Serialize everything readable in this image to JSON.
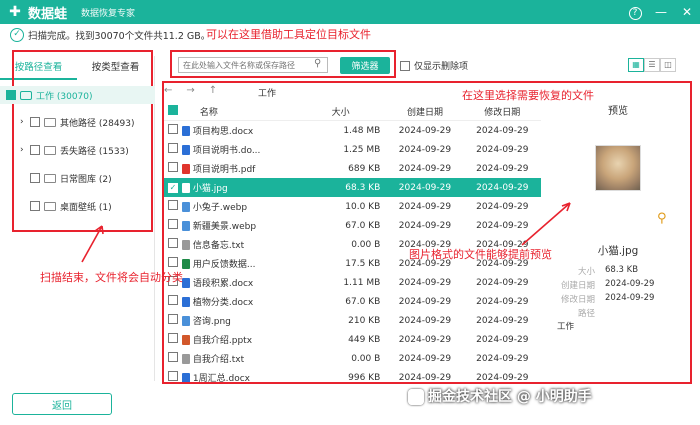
{
  "app": {
    "name": "数据蛙",
    "subtitle": "数据恢复专家",
    "window_icons": [
      "help-icon",
      "minimize-icon",
      "close-icon"
    ]
  },
  "status": {
    "text": "扫描完成。找到30070个文件共11.2 GB。"
  },
  "toolbar": {
    "search_placeholder": "在此处输入文件名称或保存路径",
    "filter_label": "筛选器",
    "show_deleted_label": "仅显示删除项"
  },
  "sidebar": {
    "tabs": [
      {
        "label": "按路径查看",
        "active": true
      },
      {
        "label": "按类型查看",
        "active": false
      }
    ],
    "root": "工作 (30070)",
    "items": [
      {
        "label": "其他路径 (28493)",
        "expandable": true
      },
      {
        "label": "丢失路径 (1533)",
        "expandable": true
      },
      {
        "label": "日常图库 (2)",
        "expandable": false
      },
      {
        "label": "桌面壁纸 (1)",
        "expandable": false
      }
    ],
    "back_label": "返回"
  },
  "nav": {
    "back": "←",
    "forward": "→",
    "up": "↑",
    "folder": "工作"
  },
  "table": {
    "headers": {
      "name": "名称",
      "size": "大小",
      "created": "创建日期",
      "modified": "修改日期"
    },
    "rows": [
      {
        "name": "项目构思.docx",
        "size": "1.48 MB",
        "created": "2024-09-29",
        "modified": "2024-09-29",
        "icon": "docx",
        "color": "#2b6fd6"
      },
      {
        "name": "项目说明书.do...",
        "size": "1.25 MB",
        "created": "2024-09-29",
        "modified": "2024-09-29",
        "icon": "docx",
        "color": "#2b6fd6"
      },
      {
        "name": "项目说明书.pdf",
        "size": "689 KB",
        "created": "2024-09-29",
        "modified": "2024-09-29",
        "icon": "pdf",
        "color": "#e0342c"
      },
      {
        "name": "小猫.jpg",
        "size": "68.3 KB",
        "created": "2024-09-29",
        "modified": "2024-09-29",
        "icon": "image",
        "color": "#ffffff",
        "selected": true
      },
      {
        "name": "小兔子.webp",
        "size": "10.0 KB",
        "created": "2024-09-29",
        "modified": "2024-09-29",
        "icon": "image",
        "color": "#4a90d9"
      },
      {
        "name": "新疆美景.webp",
        "size": "67.0 KB",
        "created": "2024-09-29",
        "modified": "2024-09-29",
        "icon": "image",
        "color": "#4a90d9"
      },
      {
        "name": "信息备忘.txt",
        "size": "0.00 B",
        "created": "2024-09-29",
        "modified": "2024-09-29",
        "icon": "txt",
        "color": "#999999"
      },
      {
        "name": "用户反馈数据...",
        "size": "17.5 KB",
        "created": "2024-09-29",
        "modified": "2024-09-29",
        "icon": "xlsx",
        "color": "#1e8a47"
      },
      {
        "name": "语段积累.docx",
        "size": "1.11 MB",
        "created": "2024-09-29",
        "modified": "2024-09-29",
        "icon": "docx",
        "color": "#2b6fd6"
      },
      {
        "name": "植物分类.docx",
        "size": "67.0 KB",
        "created": "2024-09-29",
        "modified": "2024-09-29",
        "icon": "docx",
        "color": "#2b6fd6"
      },
      {
        "name": "咨询.png",
        "size": "210 KB",
        "created": "2024-09-29",
        "modified": "2024-09-29",
        "icon": "image",
        "color": "#4a90d9"
      },
      {
        "name": "自我介绍.pptx",
        "size": "449 KB",
        "created": "2024-09-29",
        "modified": "2024-09-29",
        "icon": "pptx",
        "color": "#d2572a"
      },
      {
        "name": "自我介绍.txt",
        "size": "0.00 B",
        "created": "2024-09-29",
        "modified": "2024-09-29",
        "icon": "txt",
        "color": "#999999"
      },
      {
        "name": "1周汇总.docx",
        "size": "996 KB",
        "created": "2024-09-29",
        "modified": "2024-09-29",
        "icon": "docx",
        "color": "#2b6fd6"
      }
    ]
  },
  "preview": {
    "title": "预览",
    "file_name": "小猫.jpg",
    "size_label": "大小",
    "size": "68.3 KB",
    "created_label": "创建日期",
    "created": "2024-09-29",
    "modified_label": "修改日期",
    "modified": "2024-09-29",
    "path_label": "路径",
    "path": "工作"
  },
  "annotations": {
    "search_tip": "可以在这里借助工具定位目标文件",
    "select_tip": "在这里选择需要恢复的文件",
    "classify_tip": "扫描结束，文件将会自动分类",
    "preview_tip": "图片格式的文件能够提前预览"
  },
  "watermark": "掘金技术社区 @ 小明助手",
  "colors": {
    "accent": "#1bb39b",
    "annotation": "#e8222e"
  }
}
